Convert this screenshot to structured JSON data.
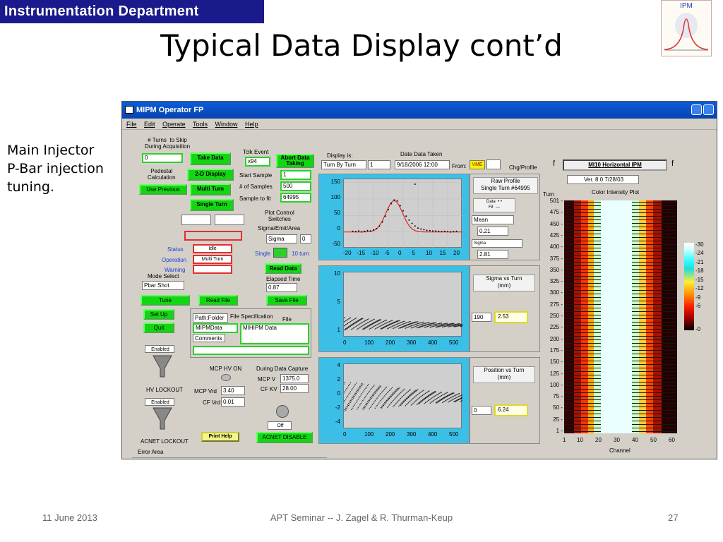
{
  "slide": {
    "department": "Instrumentation Department",
    "title": "Typical Data Display cont’d",
    "logo_text": "IPM",
    "side_text": [
      "Main Injector",
      "P-Bar injection",
      "tuning."
    ],
    "footer_date": "11 June 2013",
    "footer_center": "APT Seminar  --  J. Zagel & R. Thurman-Keup",
    "page_number": "27"
  },
  "window": {
    "title": "MIPM Operator FP",
    "menu": [
      "File",
      "Edit",
      "Operate",
      "Tools",
      "Window",
      "Help"
    ]
  },
  "left_panel": {
    "turns_label": "# Turns  to Skip\nDuring Acquisition",
    "turns_value": "0",
    "pedestal_label": "Pedestal\nCalculation",
    "use_previous": "Use Previous",
    "take_data": "Take Data",
    "display_2d": "2-D Display",
    "multi_turn": "Multi Turn",
    "single_turn": "Single Turn",
    "tclk_label": "Tclk Event",
    "tclk_value": "x94",
    "abort": "Abort Data\nTaking",
    "start_sample_label": "Start Sample",
    "start_sample": "1",
    "num_samples_label": "# of Samples",
    "num_samples": "500",
    "sample_fit_label": "Sample to fit",
    "sample_fit": "64995",
    "plot_control": "Plot Control\nSwitches",
    "sigma_label": "Sigma/Emit/Area",
    "sigma_value": "Sigma",
    "sigma_num": "0",
    "status_label": "Status",
    "status_value": "Idle",
    "operation_label": "Operation",
    "operation_value": "Multi Turn",
    "warning_label": "Warning",
    "single_label": "Single",
    "ten_turn_label": "10 turn",
    "mode_select_label": "Mode Select",
    "mode_value": "Pbar Shot",
    "read_data": "Read Data",
    "elapsed_label": "Elapsed Time",
    "elapsed_value": "0.87",
    "tune": "Tune",
    "read_file": "Read File",
    "save_file": "Save File",
    "setup": "Set Up",
    "quit": "Quit",
    "path_label": "Path:Folder",
    "file_spec_label": "File Specification",
    "file_label": "File",
    "path_value": "MIPMData",
    "file_value": "MIHIPM Data",
    "comments_label": "Comments",
    "enabled1": "Enabled",
    "hv_lockout": "HV LOCKOUT",
    "enabled2": "Enabled",
    "mcp_hv_on": "MCP HV ON",
    "mcp_vrd_label": "MCP Vrd",
    "mcp_vrd": "3.40",
    "cf_vrd_label": "CF Vrd",
    "cf_vrd": "0.01",
    "during_capture": "During Data Capture",
    "mcp_v_label": "MCP V",
    "mcp_v": "1375.0",
    "cf_kv_label": "CF KV",
    "cf_kv": "28.00",
    "off_label": "Off",
    "print_help": "Print Help",
    "acnet_disable": "ACNET DISABLE",
    "acnet_lockout": "ACNET LOCKOUT",
    "error_area": "Error Area"
  },
  "center_panel": {
    "display_is_label": "Display is:",
    "display_is": "Turn By Turn",
    "display_num": "1",
    "date_label": "Date  Data Taken",
    "date_value": "9/18/2006 12:00",
    "from_label": "From:",
    "from_value": "VME",
    "chg_profile": "Chg/Profile",
    "raw_profile": "Raw Profile\nSingle Turn #64995",
    "data_fit_legend": "Data  • •\nFit  —",
    "mean_label": "Mean",
    "mean_value": "0.21",
    "sigma_label": "Sigma",
    "sigma_value": "2.81",
    "sigma_vs_turn": "Sigma vs Turn\n(mm)",
    "sigma_turn_num": "190",
    "sigma_turn_value": "2.53",
    "position_vs_turn": "Position vs Turn\n(mm)",
    "pos_turn_num": "0",
    "pos_turn_value": "6.24"
  },
  "right_panel": {
    "ipm_name": "MI10 Horizontal IPM",
    "f_left": "f",
    "f_right": "f",
    "version": "Ver. 8.0 7/28/03",
    "color_plot_title": "Color Intensity Plot",
    "turn_label": "Turn",
    "channel_label": "Channel",
    "y_ticks": [
      "501",
      "475",
      "450",
      "425",
      "400",
      "375",
      "350",
      "325",
      "300",
      "275",
      "250",
      "225",
      "200",
      "175",
      "150",
      "125",
      "100",
      "75",
      "50",
      "25",
      "1"
    ],
    "x_ticks": [
      "1",
      "10",
      "20",
      "30",
      "40",
      "50",
      "60"
    ],
    "scale_ticks": [
      "30",
      "24",
      "21",
      "18",
      "15",
      "12",
      "9",
      "6",
      "0"
    ]
  },
  "chart_data": [
    {
      "type": "scatter",
      "name": "raw_profile",
      "x_ticks": [
        -20,
        -15,
        -10,
        -5,
        0,
        5,
        10,
        15,
        20
      ],
      "y_ticks": [
        150,
        100,
        50,
        0,
        -50
      ],
      "xlim": [
        -20,
        20
      ],
      "ylim": [
        -50,
        160
      ],
      "points": [
        [
          -17,
          2
        ],
        [
          -16,
          1
        ],
        [
          -15,
          3
        ],
        [
          -14,
          0
        ],
        [
          -13,
          2
        ],
        [
          -12,
          4
        ],
        [
          -11,
          3
        ],
        [
          -10,
          6
        ],
        [
          -9,
          10
        ],
        [
          -8,
          18
        ],
        [
          -7,
          30
        ],
        [
          -6,
          48
        ],
        [
          -5,
          68
        ],
        [
          -4,
          86
        ],
        [
          -3,
          97
        ],
        [
          -2,
          94
        ],
        [
          -1,
          80
        ],
        [
          0,
          64
        ],
        [
          1,
          48
        ],
        [
          2,
          36
        ],
        [
          3,
          26
        ],
        [
          4,
          18
        ],
        [
          5,
          12
        ],
        [
          6,
          9
        ],
        [
          7,
          7
        ],
        [
          8,
          5
        ],
        [
          9,
          4
        ],
        [
          10,
          3
        ],
        [
          11,
          3
        ],
        [
          12,
          2
        ],
        [
          13,
          1
        ],
        [
          14,
          2
        ],
        [
          15,
          1
        ],
        [
          16,
          0
        ],
        [
          17,
          1
        ],
        [
          18,
          2
        ],
        [
          4,
          145
        ]
      ],
      "fit": {
        "center": -3,
        "sigma": 2.8,
        "amplitude": 95
      }
    },
    {
      "type": "scatter",
      "name": "sigma_vs_turn",
      "x_ticks": [
        0,
        100,
        200,
        300,
        400,
        500
      ],
      "y_ticks": [
        10,
        5,
        1
      ],
      "xlim": [
        0,
        500
      ],
      "ylim": [
        1,
        10
      ],
      "band_upper": [
        [
          0,
          3.8
        ],
        [
          100,
          3.6
        ],
        [
          200,
          3.4
        ],
        [
          300,
          3.2
        ],
        [
          400,
          3.0
        ],
        [
          500,
          2.9
        ]
      ],
      "band_lower": [
        [
          0,
          2.0
        ],
        [
          100,
          2.1
        ],
        [
          200,
          2.2
        ],
        [
          300,
          2.3
        ],
        [
          400,
          2.4
        ],
        [
          500,
          2.5
        ]
      ]
    },
    {
      "type": "scatter",
      "name": "position_vs_turn",
      "x_ticks": [
        0,
        100,
        200,
        300,
        400,
        500
      ],
      "y_ticks": [
        4,
        2,
        0,
        -2,
        -4
      ],
      "xlim": [
        0,
        500
      ],
      "ylim": [
        -4,
        4
      ],
      "band_upper": [
        [
          0,
          1.8
        ],
        [
          100,
          1.6
        ],
        [
          200,
          1.2
        ],
        [
          300,
          0.9
        ],
        [
          400,
          0.6
        ],
        [
          500,
          0.4
        ]
      ],
      "band_lower": [
        [
          0,
          -1.8
        ],
        [
          100,
          -1.6
        ],
        [
          200,
          -1.3
        ],
        [
          300,
          -1.0
        ],
        [
          400,
          -0.8
        ],
        [
          500,
          -0.6
        ]
      ]
    }
  ]
}
